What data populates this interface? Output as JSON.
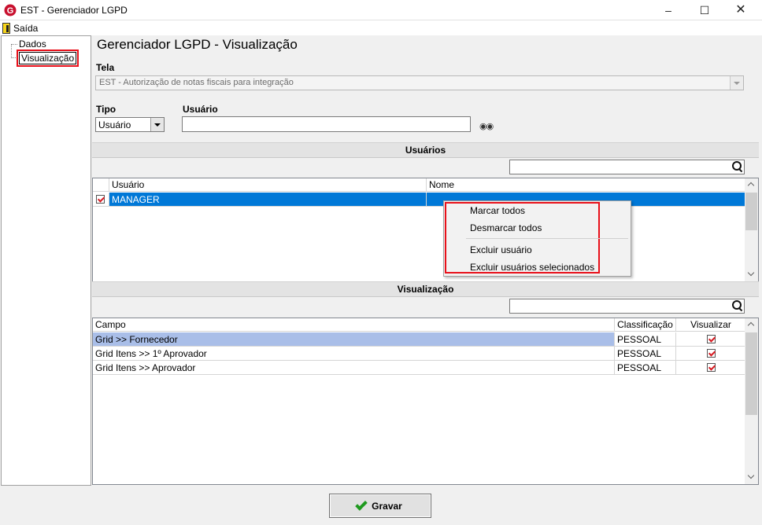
{
  "window": {
    "title": "EST - Gerenciador LGPD"
  },
  "menubar": {
    "exit_label": "Saída"
  },
  "tree": {
    "items": [
      "Dados",
      "Visualização"
    ]
  },
  "page": {
    "title": "Gerenciador LGPD - Visualização"
  },
  "form": {
    "tela_label": "Tela",
    "tela_value": "EST - Autorização de notas fiscais para integração",
    "tipo_label": "Tipo",
    "tipo_value": "Usuário",
    "usuario_label": "Usuário",
    "usuario_value": ""
  },
  "usuarios": {
    "header": "Usuários",
    "search_value": "",
    "columns": [
      "Usuário",
      "Nome"
    ],
    "rows": [
      {
        "checked": true,
        "usuario": "MANAGER",
        "nome": ""
      }
    ]
  },
  "context_menu": {
    "items": [
      "Marcar todos",
      "Desmarcar todos",
      "Excluir usuário",
      "Excluir usuários selecionados"
    ]
  },
  "visualizacao": {
    "header": "Visualização",
    "search_value": "",
    "columns": [
      "Campo",
      "Classificação",
      "Visualizar"
    ],
    "rows": [
      {
        "campo": "Grid >> Fornecedor",
        "classificacao": "PESSOAL",
        "visualizar": true
      },
      {
        "campo": "Grid Itens >> 1º Aprovador",
        "classificacao": "PESSOAL",
        "visualizar": true
      },
      {
        "campo": "Grid Itens >> Aprovador",
        "classificacao": "PESSOAL",
        "visualizar": true
      }
    ]
  },
  "footer": {
    "save_label": "Gravar"
  },
  "colors": {
    "selection_blue": "#0078d7",
    "selected_row": "#a9bee8",
    "highlight_red": "#e8101a"
  }
}
